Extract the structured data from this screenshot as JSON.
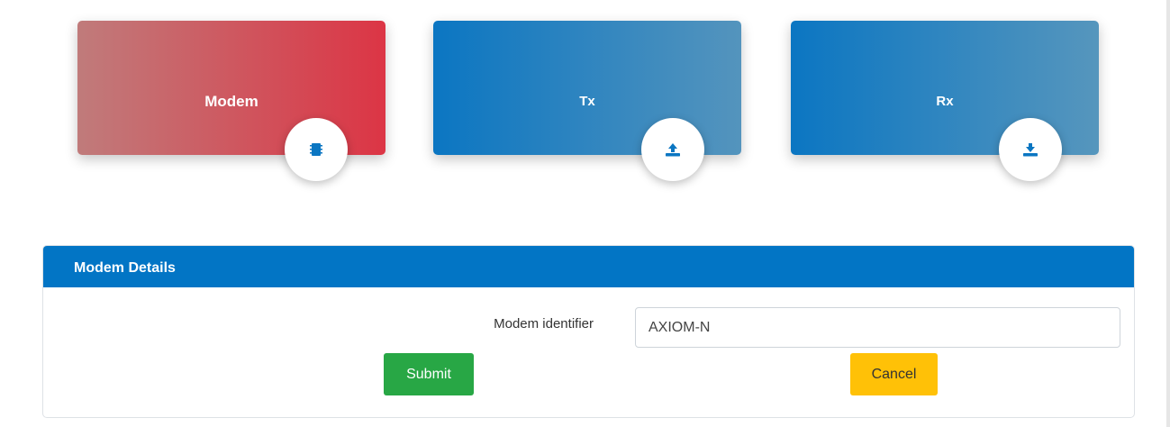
{
  "tiles": [
    {
      "title": "Modem",
      "icon": "chip-icon",
      "color": "#dc3545"
    },
    {
      "title": "Tx",
      "icon": "upload-icon",
      "color": "#0b76c2"
    },
    {
      "title": "Rx",
      "icon": "download-icon",
      "color": "#0b76c2"
    }
  ],
  "panel": {
    "header": "Modem Details",
    "header_color": "#0275c5",
    "field_label": "Modem identifier",
    "field_value": "AXIOM-N",
    "submit_label": "Submit",
    "submit_color": "#28a745",
    "cancel_label": "Cancel",
    "cancel_color": "#ffc107"
  }
}
